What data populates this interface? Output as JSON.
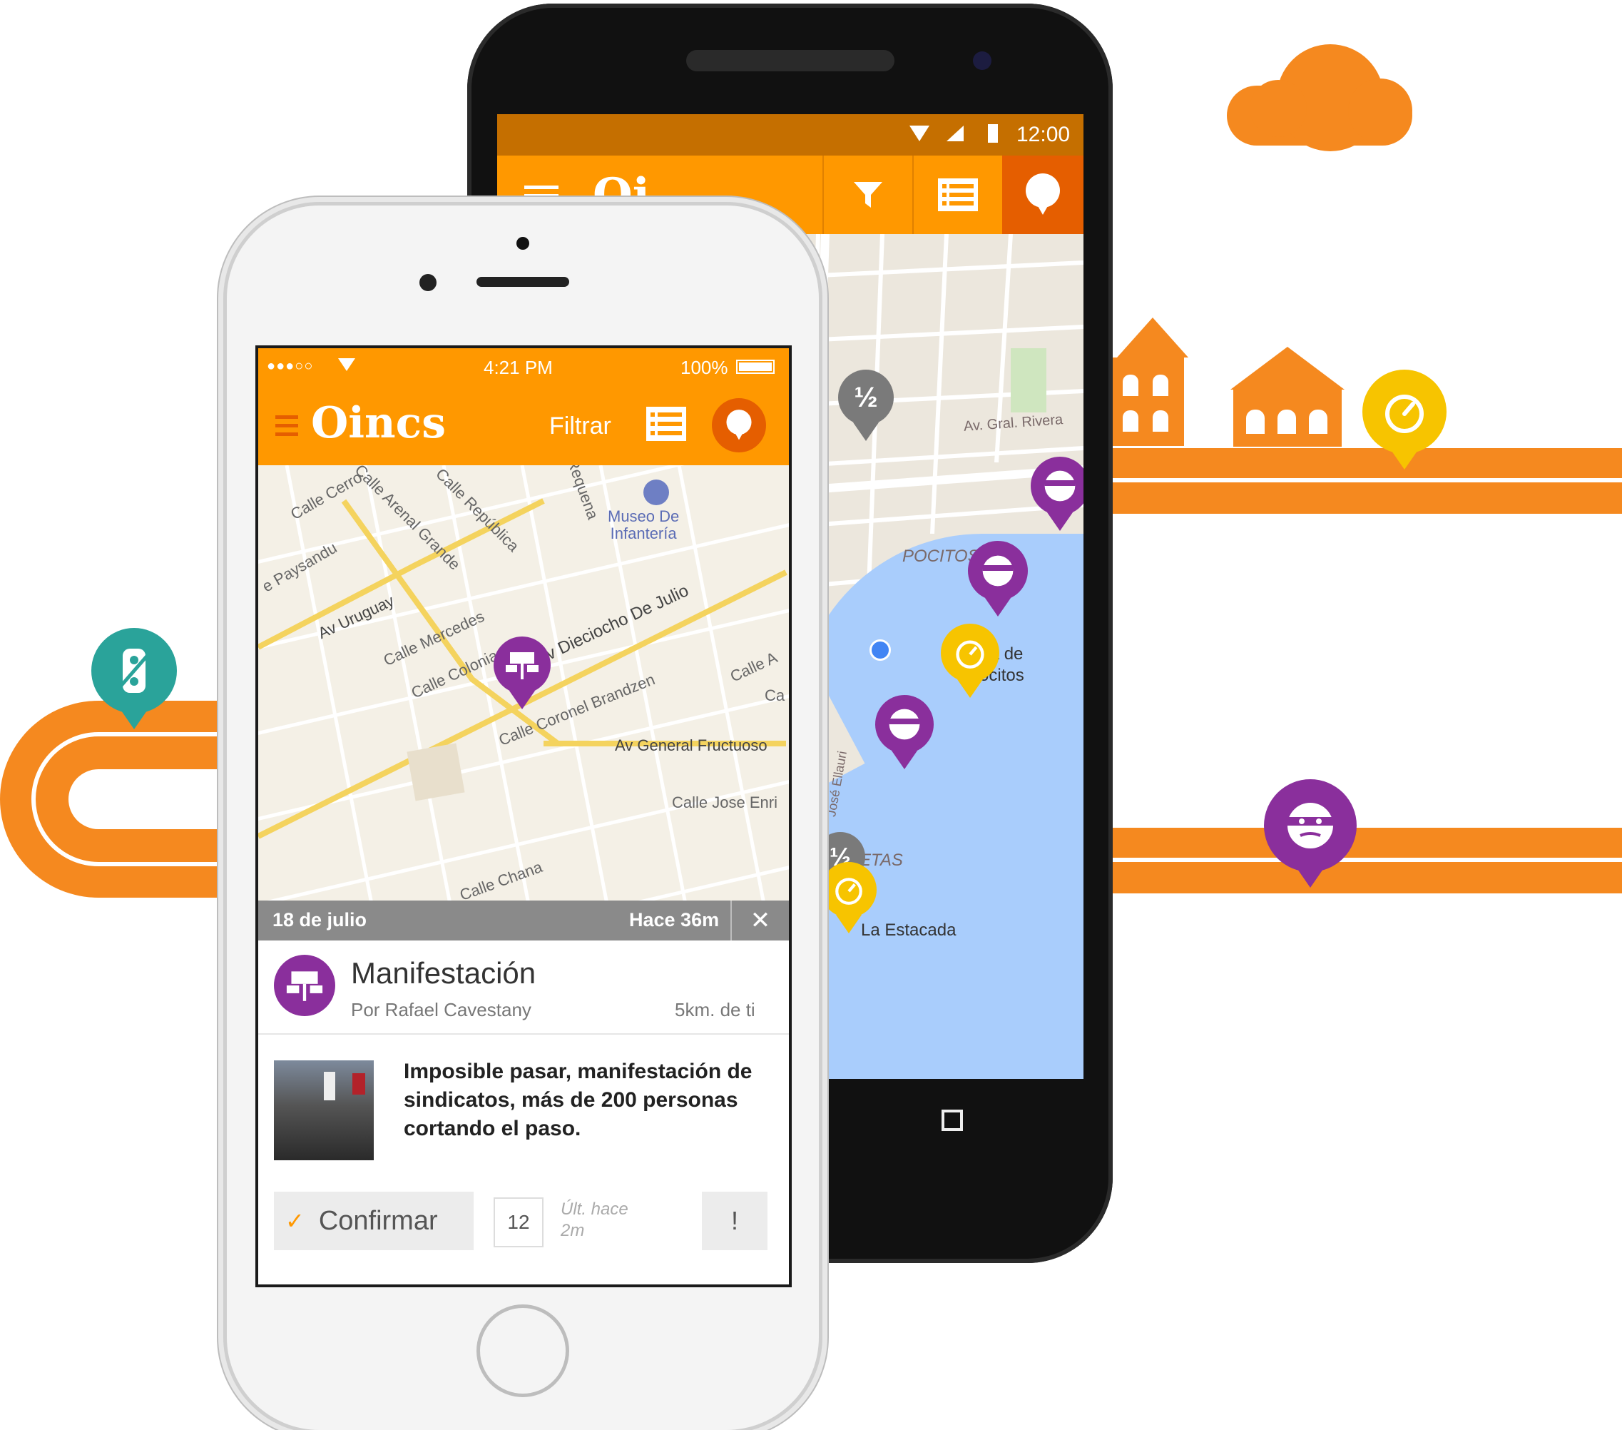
{
  "android": {
    "status_time": "12:00",
    "map_labels": {
      "street_rivera": "Av. Gral. Rivera",
      "pocitos": "POCITOS",
      "playa": "laya de\nPocitos",
      "jose": "José Ellauri",
      "etas": "ETAS",
      "estacada": "La Estacada"
    },
    "pins": {
      "half_1": "½",
      "half_2": "½"
    }
  },
  "iphone": {
    "status": {
      "signal": "●●●○○",
      "time": "4:21 PM",
      "battery": "100%"
    },
    "nav": {
      "logo": "Oincs",
      "filter_label": "Filtrar"
    },
    "map_streets": [
      "Calle Cerro",
      "Calle Arenal Grande",
      "Calle República",
      "Requena",
      "e Paysandu",
      "Av Uruguay",
      "Calle Mercedes",
      "Calle Colonia",
      "Av Dieciocho De Julio",
      "Calle Coronel Brandzen",
      "Calle A",
      "Ca",
      "Av General Fructuoso",
      "Calle Jose Enri",
      "Calle Chana"
    ],
    "museum": "Museo De\nInfantería",
    "event_bar": {
      "date": "18 de julio",
      "ago": "Hace 36m"
    },
    "event": {
      "title": "Manifestación",
      "author": "Por Rafael Cavestany",
      "distance": "5km. de ti",
      "description": "Imposible pasar, manifestación de sindicatos, más de 200 personas cortando el paso.",
      "confirm_label": "Confirmar",
      "confirm_count": "12",
      "last_label": "Últ. hace 2m",
      "report_label": "!"
    }
  },
  "colors": {
    "orange": "#ff9800",
    "road_orange": "#f5891f",
    "purple": "#8a2f9c",
    "yellow": "#f7c400",
    "teal": "#2aa39a"
  }
}
